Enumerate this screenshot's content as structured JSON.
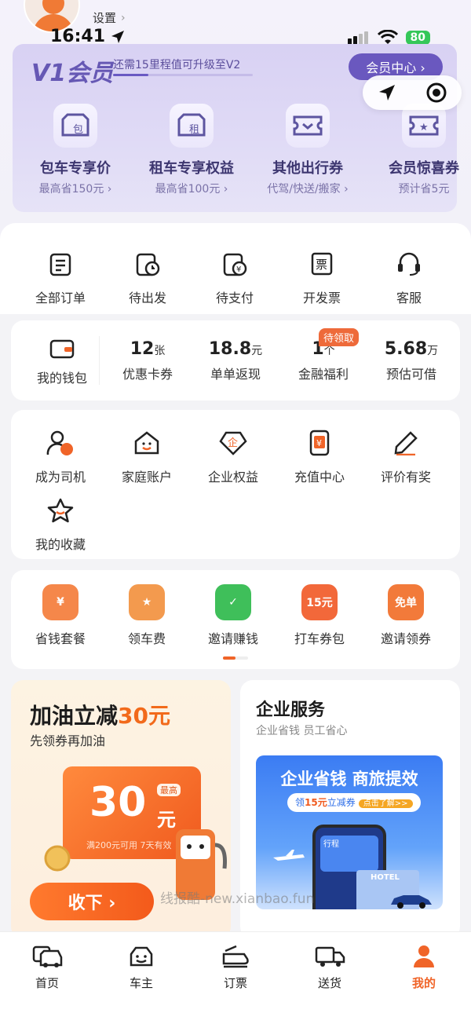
{
  "status_bar": {
    "time": "16:41",
    "battery": "80"
  },
  "profile": {
    "settings_label": "设置"
  },
  "member": {
    "level": "V1会员",
    "upgrade_text": "还需15里程值可升级至V2",
    "upgrade_progress": 0.25,
    "center_label": "会员中心 ›",
    "benefits": [
      {
        "icon": "charter-car-icon",
        "title": "包车专享价",
        "sub": "最高省150元 ›"
      },
      {
        "icon": "rent-car-icon",
        "title": "租车专享权益",
        "sub": "最高省100元 ›"
      },
      {
        "icon": "ticket-icon",
        "title": "其他出行券",
        "sub": "代驾/快送/搬家 ›"
      },
      {
        "icon": "star-ticket-icon",
        "title": "会员惊喜券",
        "sub": "预计省5元"
      }
    ]
  },
  "orders": [
    {
      "icon": "all-orders-icon",
      "label": "全部订单"
    },
    {
      "icon": "pending-departure-icon",
      "label": "待出发"
    },
    {
      "icon": "pending-payment-icon",
      "label": "待支付"
    },
    {
      "icon": "invoice-icon",
      "label": "开发票",
      "glyph": "票"
    },
    {
      "icon": "customer-service-icon",
      "label": "客服"
    }
  ],
  "wallet": {
    "label": "我的钱包",
    "items": [
      {
        "num": "12",
        "unit": "张",
        "label": "优惠卡券"
      },
      {
        "num": "18.8",
        "unit": "元",
        "label": "单单返现"
      },
      {
        "num": "1",
        "unit": "个",
        "label": "金融福利"
      },
      {
        "num": "5.68",
        "unit": "万",
        "label": "预估可借"
      }
    ],
    "badge": "待领取"
  },
  "services": [
    {
      "icon": "driver-icon",
      "label": "成为司机"
    },
    {
      "icon": "family-account-icon",
      "label": "家庭账户"
    },
    {
      "icon": "enterprise-icon",
      "label": "企业权益",
      "glyph": "企"
    },
    {
      "icon": "recharge-icon",
      "label": "充值中心",
      "glyph": "¥"
    },
    {
      "icon": "review-icon",
      "label": "评价有奖"
    },
    {
      "icon": "favorites-icon",
      "label": "我的收藏"
    }
  ],
  "promos": [
    {
      "icon": "savings-package-icon",
      "label": "省钱套餐",
      "glyph": "¥",
      "color": "#f5874a"
    },
    {
      "icon": "car-fee-icon",
      "label": "领车费",
      "glyph": "★",
      "color": "#f39a4e"
    },
    {
      "icon": "invite-earn-icon",
      "label": "邀请赚钱",
      "glyph": "✓",
      "color": "#3fbf5a"
    },
    {
      "icon": "ride-coupon-icon",
      "label": "打车券包",
      "glyph": "15元",
      "color": "#f2683a"
    },
    {
      "icon": "invite-coupon-icon",
      "label": "邀请领券",
      "glyph": "免单",
      "color": "#f27a3a"
    }
  ],
  "fuel": {
    "title_a": "加油立减",
    "title_b": "30元",
    "subtitle": "先领券再加油",
    "coupon_amount": "30",
    "coupon_unit": "元",
    "coupon_max": "最高",
    "coupon_note": "满200元可用 7天有效",
    "button": "收下 ›"
  },
  "enterprise": {
    "title": "企业服务",
    "subtitle": "企业省钱 员工省心",
    "banner_title": "企业省钱 商旅提效",
    "banner_tag_a": "领",
    "banner_tag_b": "15元",
    "banner_tag_c": "立减券",
    "banner_tag_go": "点击了解>>",
    "phone_label": "行程",
    "hotel_label": "HOTEL"
  },
  "watermark": "线报酷-new.xianbao.fun",
  "tabs": [
    {
      "icon": "home-icon",
      "label": "首页"
    },
    {
      "icon": "car-owner-icon",
      "label": "车主"
    },
    {
      "icon": "book-ticket-icon",
      "label": "订票"
    },
    {
      "icon": "delivery-icon",
      "label": "送货"
    },
    {
      "icon": "profile-icon",
      "label": "我的"
    }
  ]
}
